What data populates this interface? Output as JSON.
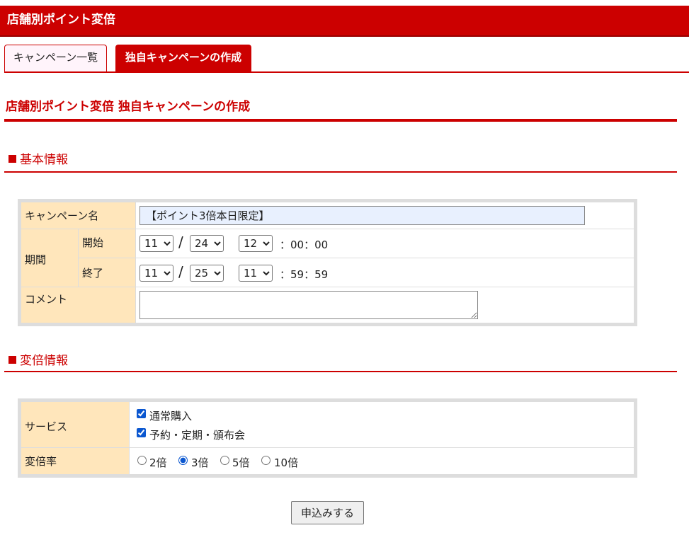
{
  "header": {
    "title": "店舗別ポイント変倍"
  },
  "tabs": [
    {
      "label": "キャンペーン一覧",
      "active": false
    },
    {
      "label": "独自キャンペーンの作成",
      "active": true
    }
  ],
  "page_title": "店舗別ポイント変倍 独自キャンペーンの作成",
  "basic_section": {
    "heading": "基本情報",
    "campaign_name_label": "キャンペーン名",
    "campaign_name_value": "【ポイント3倍本日限定】",
    "period_label": "期間",
    "start_label": "開始",
    "end_label": "終了",
    "start": {
      "month": "11",
      "day": "24",
      "hour": "12",
      "suffix": "：00：00"
    },
    "end": {
      "month": "11",
      "day": "25",
      "hour": "11",
      "suffix": "：59：59"
    },
    "date_separator": "/",
    "comment_label": "コメント",
    "comment_value": ""
  },
  "multiplier_section": {
    "heading": "変倍情報",
    "service_label": "サービス",
    "services": [
      {
        "label": "通常購入",
        "checked": true
      },
      {
        "label": "予約・定期・頒布会",
        "checked": true
      }
    ],
    "rate_label": "変倍率",
    "rates": [
      {
        "label": "2倍",
        "checked": false
      },
      {
        "label": "3倍",
        "checked": true
      },
      {
        "label": "5倍",
        "checked": false
      },
      {
        "label": "10倍",
        "checked": false
      }
    ]
  },
  "submit_label": "申込みする",
  "colors": {
    "brand_red": "#cc0000",
    "label_bg": "#ffe6bb",
    "table_border": "#dddddd"
  }
}
